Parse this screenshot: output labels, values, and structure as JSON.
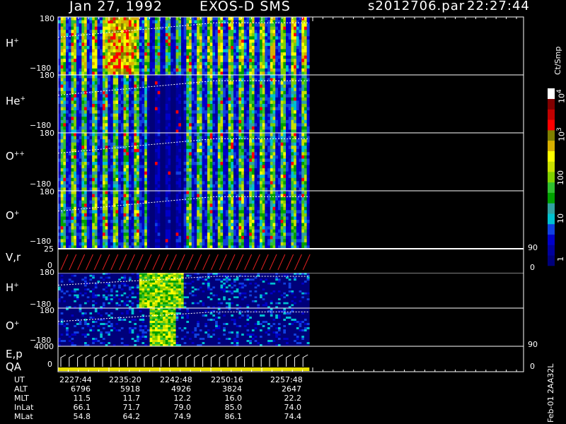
{
  "header": {
    "date": "Jan 27, 1992",
    "instrument": "EXOS-D SMS",
    "file": "s2012706.par",
    "time": "22:27:44"
  },
  "colorbar": {
    "unit_label": "Ct/Smp",
    "tick_1": "1",
    "tick_10": "10",
    "tick_100": "100",
    "tick_1e3_base": "10",
    "tick_1e3_exp": "3",
    "tick_1e4_base": "10",
    "tick_1e4_exp": "4",
    "colors": [
      "#00007a",
      "#00009c",
      "#0000c8",
      "#1040e0",
      "#00c0d0",
      "#30a0a0",
      "#00a000",
      "#30c030",
      "#80d000",
      "#c8e000",
      "#ffff00",
      "#d8b000",
      "#808000",
      "#ff0000",
      "#c00000",
      "#800000",
      "#ffffff"
    ]
  },
  "panels": [
    {
      "label": "H",
      "sup": "+",
      "top": "180",
      "bottom": "−180"
    },
    {
      "label": "He",
      "sup": "+",
      "top": "180",
      "bottom": "−180"
    },
    {
      "label": "O",
      "sup": "++",
      "top": "180",
      "bottom": "−180"
    },
    {
      "label": "O",
      "sup": "+",
      "top": "180",
      "bottom": "−180"
    },
    {
      "label": "V,r",
      "sup": "",
      "top": "25",
      "bottom": "0",
      "right_top": "90",
      "right_bottom": "0"
    },
    {
      "label": "H",
      "sup": "+",
      "top": "180",
      "bottom": "−180"
    },
    {
      "label": "O",
      "sup": "+",
      "top": "180",
      "bottom": "−180"
    },
    {
      "label": "E,p",
      "sup": "",
      "top": "4000",
      "bottom": "0",
      "right_top": "90",
      "right_bottom": "0"
    }
  ],
  "qa_label": "QA",
  "footer": {
    "row_labels": [
      "UT",
      "ALT",
      "MLT",
      "InLat",
      "MLat"
    ],
    "columns": [
      [
        "2227:44",
        "6796",
        "11.5",
        "66.1",
        "54.8"
      ],
      [
        "2235:20",
        "5918",
        "11.7",
        "71.7",
        "64.2"
      ],
      [
        "2242:48",
        "4926",
        "12.2",
        "79.0",
        "74.9"
      ],
      [
        "2250:16",
        "3824",
        "16.0",
        "85.0",
        "86.1"
      ],
      [
        "2257:48",
        "2647",
        "22.2",
        "74.0",
        "74.4"
      ]
    ]
  },
  "side_note": "Feb-01 2AA32L",
  "chart_data": {
    "type": "heatmap",
    "title": "Jan 27, 1992   EXOS-D SMS",
    "x_ticks": [
      "2227:44",
      "2235:20",
      "2242:48",
      "2250:16",
      "2257:48"
    ],
    "series": [
      {
        "name": "H+",
        "ylim": [
          -180,
          180
        ],
        "strength": 1.0,
        "hole": 0.2,
        "burst": [
          0.19,
          0.3
        ]
      },
      {
        "name": "He+",
        "ylim": [
          -180,
          180
        ],
        "strength": 0.55,
        "hole": 0.75,
        "burst": null
      },
      {
        "name": "O++",
        "ylim": [
          -180,
          180
        ],
        "strength": 0.55,
        "hole": 0.7,
        "burst": null
      },
      {
        "name": "O+",
        "ylim": [
          -180,
          180
        ],
        "strength": 0.6,
        "hole": 0.7,
        "burst": null
      },
      {
        "name": "H+",
        "ylim": [
          -180,
          180
        ],
        "strength": 0.45,
        "hole": 0.0,
        "burst": [
          0.32,
          0.5
        ],
        "sparse": true
      },
      {
        "name": "O+",
        "ylim": [
          -180,
          180
        ],
        "strength": 0.35,
        "hole": 0.0,
        "burst": [
          0.36,
          0.46
        ],
        "sparse": true
      }
    ],
    "data_extent_fraction": 0.54,
    "colorbar_scale": "log",
    "colorbar_range": [
      1,
      10000
    ]
  }
}
